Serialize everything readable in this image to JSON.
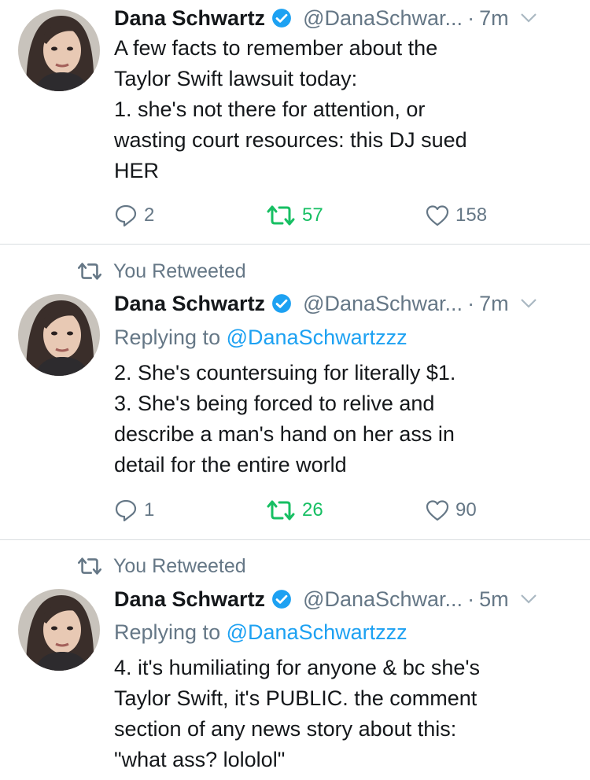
{
  "tweets": [
    {
      "retweeted_label": "",
      "name": "Dana Schwartz",
      "handle": "@DanaSchwar...",
      "time": "7m",
      "replying_label": "",
      "replying_mention": "",
      "body_lines": [
        "A few facts to remember about the",
        "Taylor Swift lawsuit today:",
        "1. she's not there for attention, or",
        "wasting court resources: this DJ sued",
        "HER"
      ],
      "replies": "2",
      "retweets": "57",
      "likes": "158"
    },
    {
      "retweeted_label": "You Retweeted",
      "name": "Dana Schwartz",
      "handle": "@DanaSchwar...",
      "time": "7m",
      "replying_label": "Replying to",
      "replying_mention": "@DanaSchwartzzz",
      "body_lines": [
        "2. She's countersuing for literally $1.",
        "3. She's being forced to relive and",
        "describe a man's hand on her ass in",
        "detail for the entire world"
      ],
      "replies": "1",
      "retweets": "26",
      "likes": "90"
    },
    {
      "retweeted_label": "You Retweeted",
      "name": "Dana Schwartz",
      "handle": "@DanaSchwar...",
      "time": "5m",
      "replying_label": "Replying to",
      "replying_mention": "@DanaSchwartzzz",
      "body_lines": [
        "4. it's humiliating for anyone & bc she's",
        "Taylor Swift, it's PUBLIC. the comment",
        "section of any news story about this:",
        "\"what ass? lololol\""
      ],
      "replies": "",
      "retweets": "",
      "likes": ""
    }
  ],
  "icons": {
    "verified": "verified-badge-icon",
    "caret": "chevron-down-icon",
    "reply": "reply-icon",
    "retweet": "retweet-icon",
    "like": "heart-icon"
  },
  "colors": {
    "text": "#14171a",
    "secondary": "#657786",
    "link": "#1da1f2",
    "retweet": "#17bf63",
    "divider": "#d9dde0"
  }
}
